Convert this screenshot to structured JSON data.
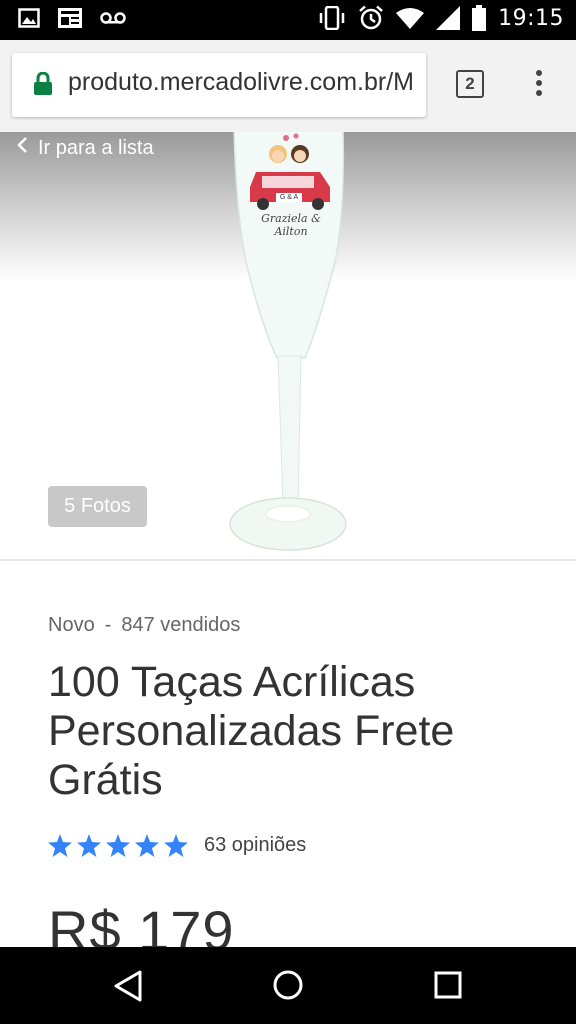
{
  "status_bar": {
    "time": "19:15",
    "left_icons": [
      "image-icon",
      "news-icon",
      "voicemail-icon"
    ],
    "right_icons": [
      "vibrate-icon",
      "alarm-icon",
      "wifi-icon",
      "signal-icon",
      "battery-icon"
    ]
  },
  "browser": {
    "url": "produto.mercadolivre.com.br/M",
    "tab_count": "2",
    "secure_color": "#0b8043"
  },
  "product": {
    "back_label": "Ir para a lista",
    "photos_label": "5 Fotos",
    "condition": "Novo",
    "separator": "-",
    "sold": "847 vendidos",
    "title": "100 Taças Acrílicas Personalizadas Frete Grátis",
    "rating_stars": 5,
    "star_color": "#3483fa",
    "reviews": "63 opiniões",
    "price": "R$ 179",
    "glass_print": {
      "initials": "G & A",
      "names": "Graziela & Ailton"
    }
  },
  "nav_bar": {
    "buttons": [
      "back-icon",
      "home-icon",
      "recents-icon"
    ]
  }
}
